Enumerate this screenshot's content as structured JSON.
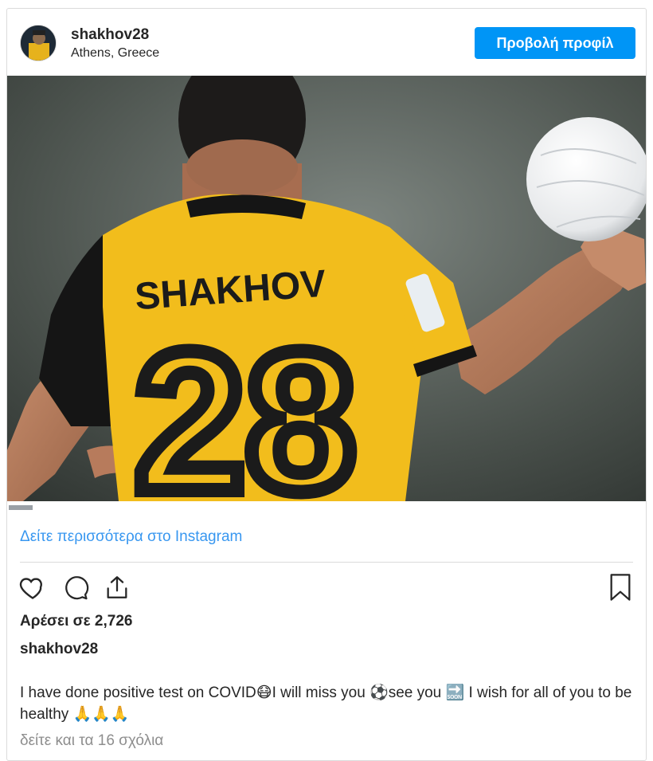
{
  "header": {
    "username": "shakhov28",
    "location": "Athens, Greece",
    "view_profile_label": "Προβολή προφίλ"
  },
  "photo": {
    "shirt_name": "SHAKHOV",
    "shirt_number": "28"
  },
  "links": {
    "more_on_instagram": "Δείτε περισσότερα στο Instagram"
  },
  "actions": {
    "like_icon": "heart-icon",
    "comment_icon": "comment-icon",
    "share_icon": "share-icon",
    "save_icon": "bookmark-icon"
  },
  "likes_text": "Αρέσει σε 2,726",
  "caption": {
    "username": "shakhov28",
    "text": "I have done positive test on COVID😷I will miss you ⚽see you 🔜 I wish for all of you to be healthy 🙏🙏🙏"
  },
  "comments_link": "δείτε και τα 16 σχόλια",
  "colors": {
    "primary_button": "#0095f6",
    "link": "#3897f0",
    "muted": "#8e8e8e",
    "jersey_yellow": "#f2bd1c"
  }
}
